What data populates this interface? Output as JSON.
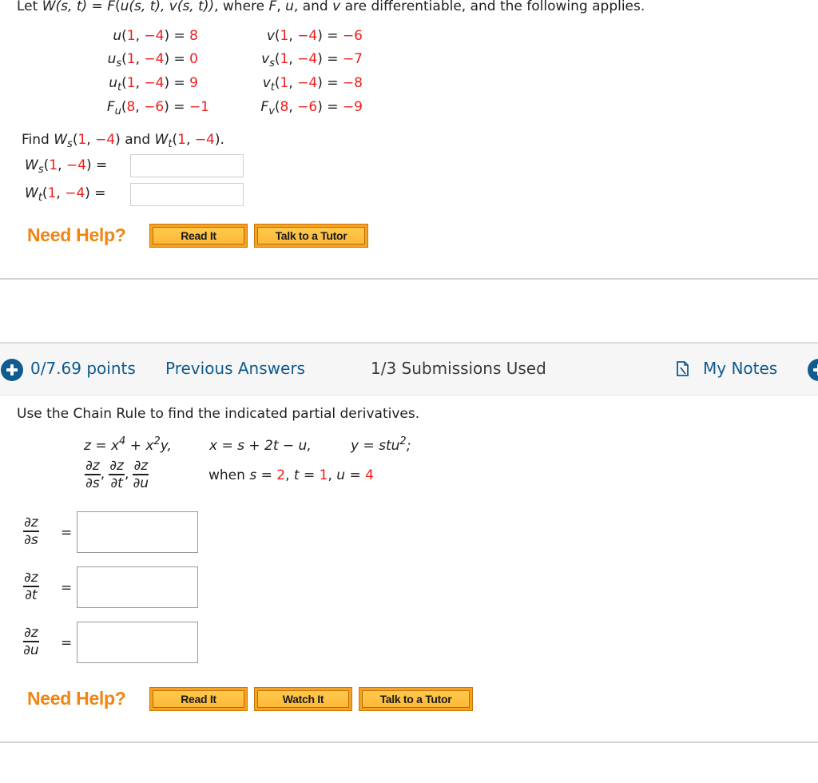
{
  "question1": {
    "intro": {
      "prefix": "Let ",
      "W": "W",
      "args_st": "(s, t)",
      "eq": " = ",
      "F": "F",
      "open": "(",
      "u": "u",
      "args_u": "(s, t), ",
      "v": "v",
      "args_v": "(s, t))",
      "mid": ", where ",
      "F2": "F",
      "c1": ", ",
      "u2": "u",
      "and": ", and ",
      "v2": "v",
      "suffix": " are differentiable, and the following applies."
    },
    "given": [
      {
        "fn": "u",
        "sub": "",
        "a": "1",
        "b": "−4",
        "value": "8"
      },
      {
        "fn": "v",
        "sub": "",
        "a": "1",
        "b": "−4",
        "value": "−6"
      },
      {
        "fn": "u",
        "sub": "s",
        "a": "1",
        "b": "−4",
        "value": "0"
      },
      {
        "fn": "v",
        "sub": "s",
        "a": "1",
        "b": "−4",
        "value": "−7"
      },
      {
        "fn": "u",
        "sub": "t",
        "a": "1",
        "b": "−4",
        "value": "9"
      },
      {
        "fn": "v",
        "sub": "t",
        "a": "1",
        "b": "−4",
        "value": "−8"
      },
      {
        "fn": "F",
        "sub": "u",
        "a": "8",
        "b": "−6",
        "value": "−1"
      },
      {
        "fn": "F",
        "sub": "v",
        "a": "8",
        "b": "−6",
        "value": "−9"
      }
    ],
    "find": {
      "prefix": "Find ",
      "W1": "W",
      "sub1": "s",
      "a1": "1",
      "b1": "−4",
      "and": ") and ",
      "W2": "W",
      "sub2": "t",
      "a2": "1",
      "b2": "−4",
      "suffix": ")."
    },
    "answers": [
      {
        "fn": "W",
        "sub": "s",
        "a": "1",
        "b": "−4",
        "eq": ") =",
        "value": ""
      },
      {
        "fn": "W",
        "sub": "t",
        "a": "1",
        "b": "−4",
        "eq": ") =",
        "value": ""
      }
    ],
    "help": {
      "label": "Need Help?",
      "buttons": [
        "Read It",
        "Talk to a Tutor"
      ]
    }
  },
  "question2": {
    "header": {
      "points": "0/7.69 points",
      "previous_answers": "Previous Answers",
      "submissions": "1/3 Submissions Used",
      "my_notes": "My Notes"
    },
    "intro": "Use the Chain Rule to find the indicated partial derivatives.",
    "equation": {
      "z_def_a": "z = x",
      "z_exp1": "4",
      "z_def_b": " + x",
      "z_exp2": "2",
      "z_def_c": "y,",
      "x_def": "x = s + 2t − u,",
      "y_def_a": "y = stu",
      "y_exp": "2",
      "y_def_b": ";"
    },
    "targets": [
      {
        "num": "∂z",
        "den": "∂s"
      },
      {
        "num": "∂z",
        "den": "∂t"
      },
      {
        "num": "∂z",
        "den": "∂u"
      }
    ],
    "when": {
      "prefix": "when ",
      "s_label": "s",
      "eq1": " = ",
      "s_val": "2",
      "t_label": "t",
      "eq2": " = ",
      "t_val": "1",
      "u_label": "u",
      "eq3": " = ",
      "u_val": "4",
      "sep": ", "
    },
    "answers": [
      {
        "num": "∂z",
        "den": "∂s",
        "eq": "=",
        "value": ""
      },
      {
        "num": "∂z",
        "den": "∂t",
        "eq": "=",
        "value": ""
      },
      {
        "num": "∂z",
        "den": "∂u",
        "eq": "=",
        "value": ""
      }
    ],
    "help": {
      "label": "Need Help?",
      "buttons": [
        "Read It",
        "Watch It",
        "Talk to a Tutor"
      ]
    }
  },
  "colors": {
    "given_value": "#ee1c1c",
    "need_help": "#f08512",
    "button": "#f7a21f",
    "link_blue": "#0e5a8f"
  }
}
